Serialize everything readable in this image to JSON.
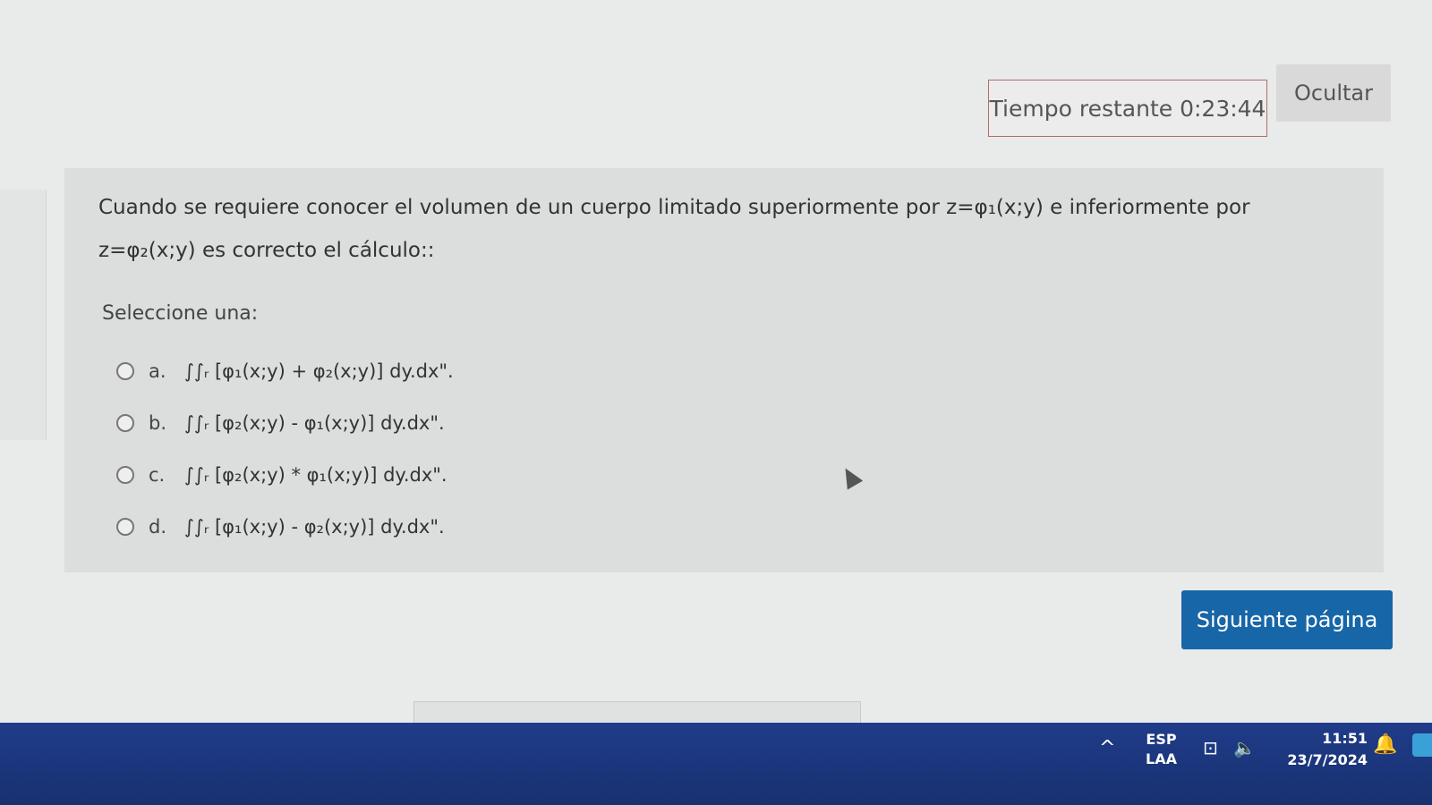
{
  "timer": {
    "label": "Tiempo restante",
    "value": "0:23:44"
  },
  "hide_button": "Ocultar",
  "question": {
    "text": "Cuando se requiere conocer el volumen de un cuerpo limitado superiormente por z=φ₁(x;y) e inferiormente por z=φ₂(x;y) es correcto el cálculo::",
    "prompt": "Seleccione una:",
    "answers": [
      {
        "letter": "a.",
        "formula": "∫∫ᵣ [φ₁(x;y) + φ₂(x;y)] dy.dx\"."
      },
      {
        "letter": "b.",
        "formula": "∫∫ᵣ [φ₂(x;y) - φ₁(x;y)] dy.dx\"."
      },
      {
        "letter": "c.",
        "formula": "∫∫ᵣ [φ₂(x;y) * φ₁(x;y)] dy.dx\"."
      },
      {
        "letter": "d.",
        "formula": "∫∫ᵣ [φ₁(x;y) - φ₂(x;y)] dy.dx\"."
      }
    ]
  },
  "next_button": "Siguiente página",
  "taskbar": {
    "lang_top": "ESP",
    "lang_bottom": "LAA",
    "time": "11:51",
    "date": "23/7/2024",
    "chevron": "^",
    "network_glyph": "⊡",
    "volume_glyph": "🔈",
    "notification_glyph": "🔔"
  }
}
